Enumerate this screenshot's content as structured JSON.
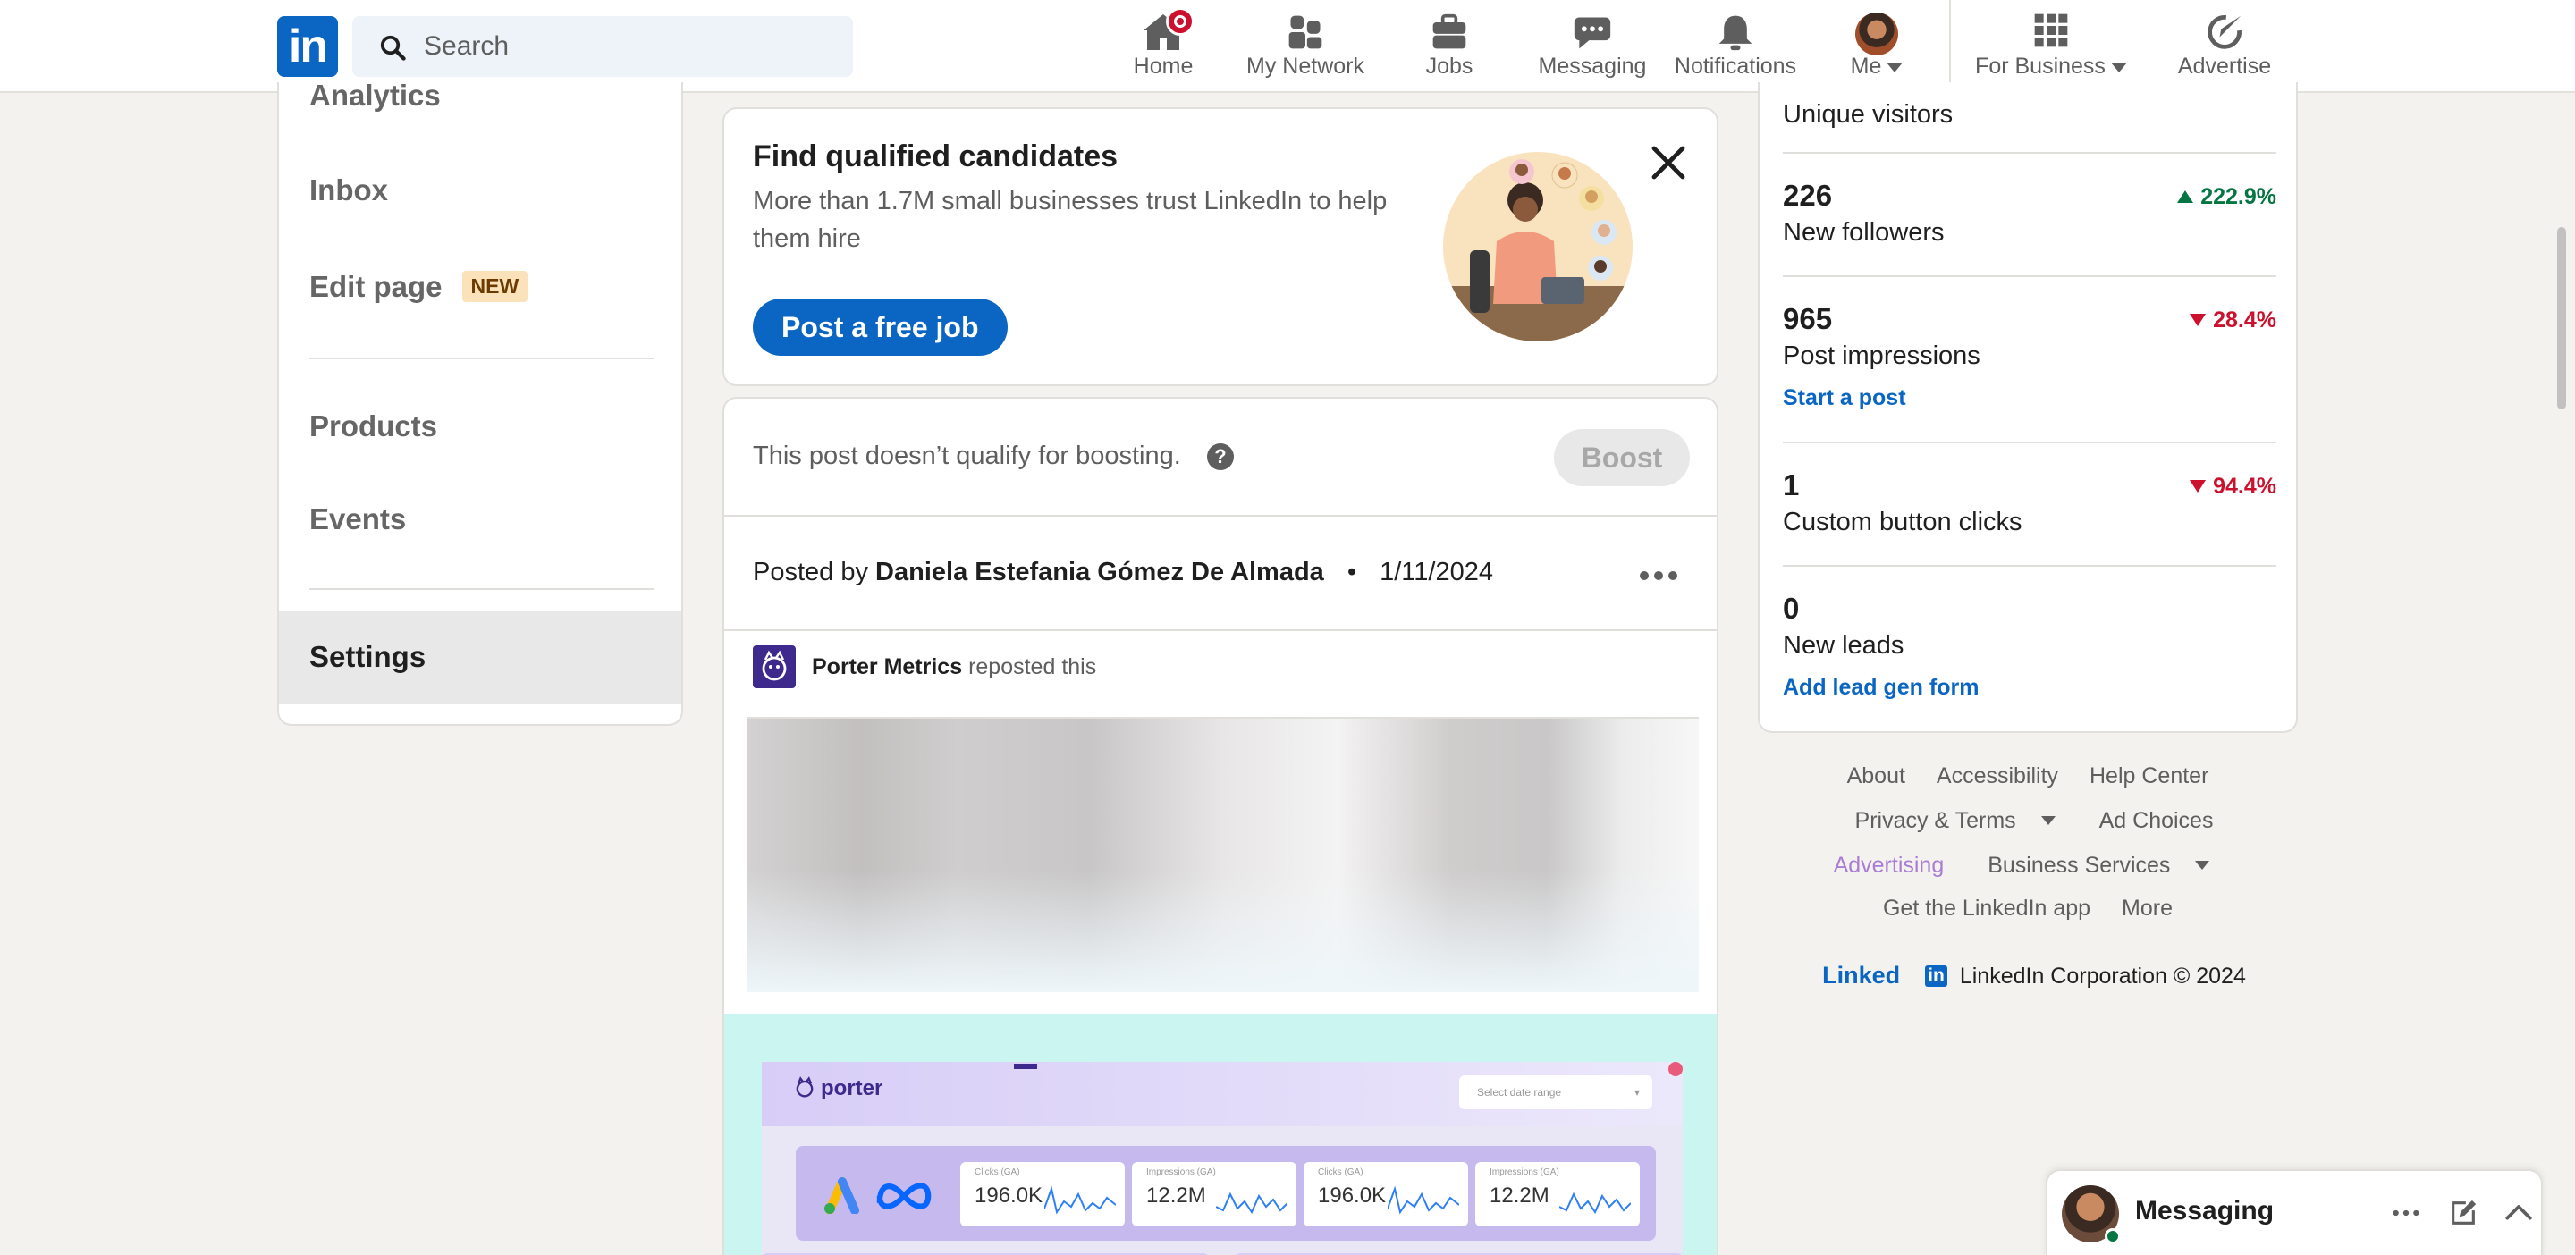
{
  "nav": {
    "search_placeholder": "Search",
    "items": [
      {
        "label": "Home",
        "icon": "home-icon"
      },
      {
        "label": "My Network",
        "icon": "people-icon"
      },
      {
        "label": "Jobs",
        "icon": "briefcase-icon"
      },
      {
        "label": "Messaging",
        "icon": "chat-icon"
      },
      {
        "label": "Notifications",
        "icon": "bell-icon"
      },
      {
        "label": "Me",
        "icon": "avatar"
      },
      {
        "label": "For Business",
        "icon": "grid-icon"
      },
      {
        "label": "Advertise",
        "icon": "compass-icon"
      }
    ],
    "brand_color": "#0a66c2",
    "badge_color": "#cb112d"
  },
  "sidebar": {
    "items": [
      {
        "label": "Analytics"
      },
      {
        "label": "Inbox"
      },
      {
        "label": "Edit page",
        "tag": "NEW"
      },
      {
        "label": "Products"
      },
      {
        "label": "Events"
      },
      {
        "label": "Settings"
      }
    ]
  },
  "promo": {
    "title": "Find qualified candidates",
    "body": "More than 1.7M small businesses trust LinkedIn to help them hire",
    "cta": "Post a free job"
  },
  "post": {
    "boost_note": "This post doesn’t qualify for boosting.",
    "boost_label": "Boost",
    "posted_by_prefix": "Posted by",
    "author": "Daniela Estefania Gómez De Almada",
    "separator": "•",
    "date": "1/11/2024",
    "reposter": "Porter Metrics",
    "repost_suffix": "reposted this",
    "image": {
      "brand": "porter",
      "date_select_placeholder": "Select date range",
      "kpis": [
        {
          "label": "Clicks (GA)",
          "value": "196.0K"
        },
        {
          "label": "Impressions (GA)",
          "value": "12.2M"
        },
        {
          "label": "Clicks (GA)",
          "value": "196.0K"
        },
        {
          "label": "Impressions (GA)",
          "value": "12.2M"
        }
      ]
    }
  },
  "stats": {
    "items": [
      {
        "value": "",
        "label": "Unique visitors",
        "change": "",
        "direction": ""
      },
      {
        "value": "226",
        "label": "New followers",
        "change": "222.9%",
        "direction": "up"
      },
      {
        "value": "965",
        "label": "Post impressions",
        "change": "28.4%",
        "direction": "down",
        "link": "Start a post"
      },
      {
        "value": "1",
        "label": "Custom button clicks",
        "change": "94.4%",
        "direction": "down"
      },
      {
        "value": "0",
        "label": "New leads",
        "change": "",
        "direction": "",
        "link": "Add lead gen form"
      }
    ],
    "up_color": "#057642",
    "down_color": "#cb112d"
  },
  "footer": {
    "about": "About",
    "accessibility": "Accessibility",
    "help": "Help Center",
    "privacy": "Privacy & Terms",
    "ad_choices": "Ad Choices",
    "advertising": "Advertising",
    "business_services": "Business Services",
    "get_app": "Get the LinkedIn app",
    "more": "More",
    "logo_word": "Linked",
    "logo_box": "in",
    "copyright": "LinkedIn Corporation © 2024"
  },
  "messaging_bar": {
    "title": "Messaging"
  }
}
